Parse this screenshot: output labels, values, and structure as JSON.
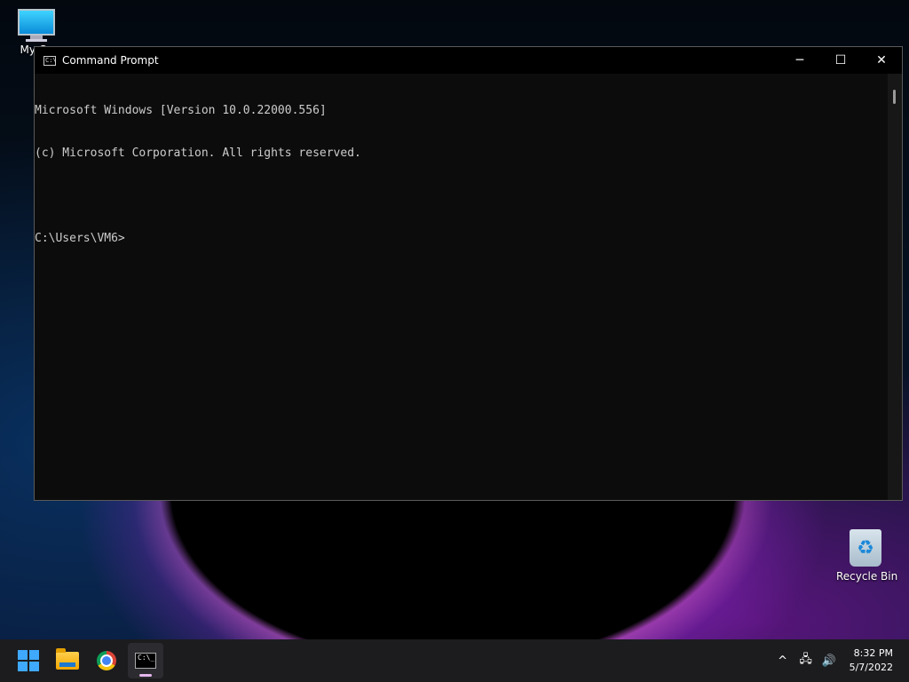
{
  "desktop": {
    "icons": [
      {
        "label": "My Co"
      },
      {
        "label": "Recycle Bin"
      }
    ]
  },
  "window": {
    "title": "Command Prompt",
    "title_icon_text": "C:\\",
    "controls": {
      "minimize": "─",
      "maximize": "☐",
      "close": "✕"
    },
    "console_lines": [
      "Microsoft Windows [Version 10.0.22000.556]",
      "(c) Microsoft Corporation. All rights reserved.",
      "",
      "C:\\Users\\VM6>"
    ]
  },
  "taskbar": {
    "apps": [
      {
        "name": "start",
        "icon": "windows-logo-icon"
      },
      {
        "name": "file-explorer",
        "icon": "folder-icon"
      },
      {
        "name": "chrome",
        "icon": "chrome-icon"
      },
      {
        "name": "command-prompt",
        "icon": "cmd-icon",
        "active": true
      }
    ],
    "cmd_icon_text": "C:\\_",
    "tray": {
      "chevron": "^",
      "network": "🖧",
      "volume": "🔊"
    },
    "time": "8:32 PM",
    "date": "5/7/2022"
  },
  "colors": {
    "console_bg": "#0c0c0c",
    "console_text": "#cccccc",
    "taskbar_bg": "#1c1c1f",
    "accent": "#3fa9ff"
  }
}
